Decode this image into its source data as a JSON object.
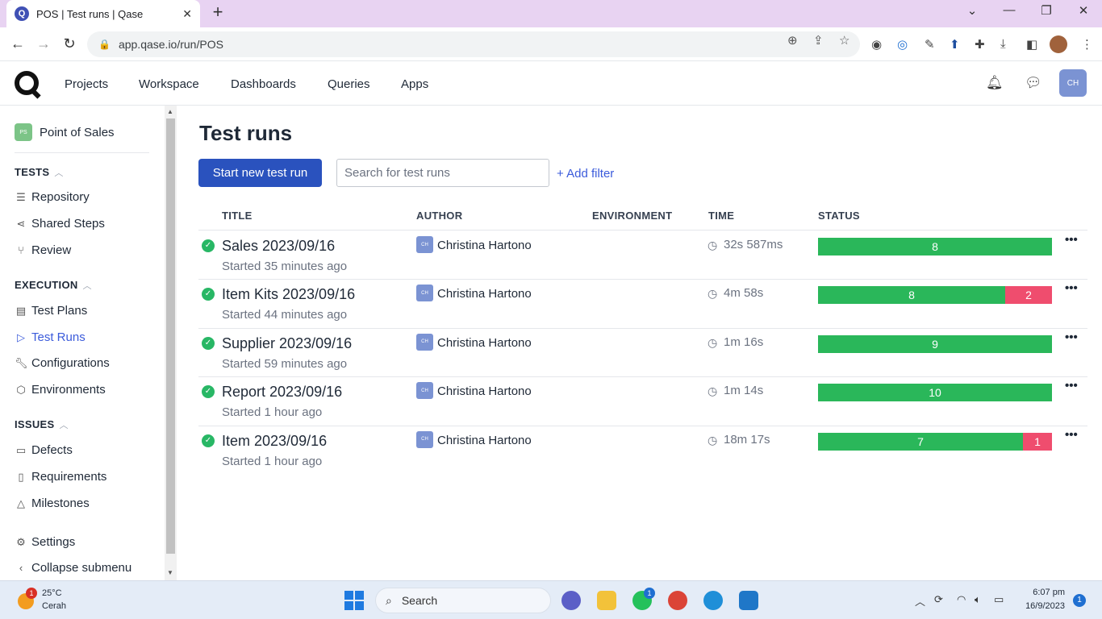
{
  "browser": {
    "tab_title": "POS | Test runs | Qase",
    "favicon_letter": "Q",
    "url": "app.qase.io/run/POS"
  },
  "appnav": {
    "items": [
      "Projects",
      "Workspace",
      "Dashboards",
      "Queries",
      "Apps"
    ],
    "user_initials": "CH"
  },
  "sidebar": {
    "project_badge": "PS",
    "project_name": "Point of Sales",
    "sections": [
      {
        "title": "TESTS",
        "items": [
          "Repository",
          "Shared Steps",
          "Review"
        ]
      },
      {
        "title": "EXECUTION",
        "items": [
          "Test Plans",
          "Test Runs",
          "Configurations",
          "Environments"
        ]
      },
      {
        "title": "ISSUES",
        "items": [
          "Defects",
          "Requirements",
          "Milestones"
        ]
      }
    ],
    "settings": "Settings",
    "collapse": "Collapse submenu"
  },
  "main": {
    "title": "Test runs",
    "start_button": "Start new test run",
    "search_placeholder": "Search for test runs",
    "add_filter": "+ Add filter",
    "columns": [
      "TITLE",
      "AUTHOR",
      "ENVIRONMENT",
      "TIME",
      "STATUS"
    ],
    "runs": [
      {
        "title": "Sales 2023/09/16",
        "started": "Started 35 minutes ago",
        "avatar": "CH",
        "author": "Christina Hartono",
        "time": "32s 587ms",
        "passed": "8",
        "failed": "",
        "pass_fraction": 1.0
      },
      {
        "title": "Item Kits 2023/09/16",
        "started": "Started 44 minutes ago",
        "avatar": "CH",
        "author": "Christina Hartono",
        "time": "4m 58s",
        "passed": "8",
        "failed": "2",
        "pass_fraction": 0.8
      },
      {
        "title": "Supplier 2023/09/16",
        "started": "Started 59 minutes ago",
        "avatar": "CH",
        "author": "Christina Hartono",
        "time": "1m 16s",
        "passed": "9",
        "failed": "",
        "pass_fraction": 1.0
      },
      {
        "title": "Report 2023/09/16",
        "started": "Started 1 hour ago",
        "avatar": "CH",
        "author": "Christina Hartono",
        "time": "1m 14s",
        "passed": "10",
        "failed": "",
        "pass_fraction": 1.0
      },
      {
        "title": "Item 2023/09/16",
        "started": "Started 1 hour ago",
        "avatar": "CH",
        "author": "Christina Hartono",
        "time": "18m 17s",
        "passed": "7",
        "failed": "1",
        "pass_fraction": 0.875
      }
    ]
  },
  "taskbar": {
    "weather_badge": "1",
    "temperature": "25°C",
    "condition": "Cerah",
    "search_label": "Search",
    "whatsapp_badge": "1",
    "time": "6:07 pm",
    "date": "16/9/2023",
    "notification_count": "1"
  },
  "colors": {
    "primary": "#2a52be",
    "pass": "#2ab75a",
    "fail": "#ef4d6e",
    "link": "#3b5bdb"
  }
}
